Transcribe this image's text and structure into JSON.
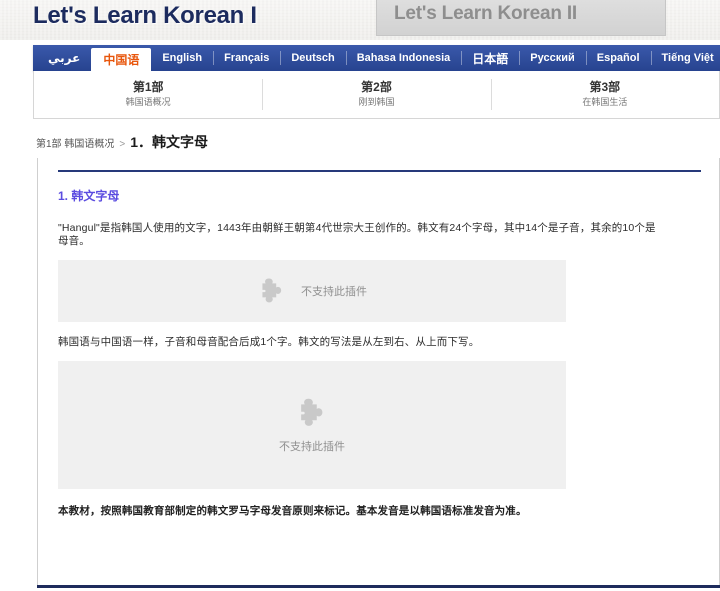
{
  "banner": {
    "title_active": "Let's Learn Korean I",
    "title_inactive": "Let's Learn Korean II"
  },
  "languages": [
    {
      "label": "عربي",
      "code": "ar",
      "active": false
    },
    {
      "label": "中国语",
      "code": "zh",
      "active": true
    },
    {
      "label": "English",
      "code": "en",
      "active": false
    },
    {
      "label": "Français",
      "code": "fr",
      "active": false
    },
    {
      "label": "Deutsch",
      "code": "de",
      "active": false
    },
    {
      "label": "Bahasa Indonesia",
      "code": "id",
      "active": false
    },
    {
      "label": "日本語",
      "code": "ja",
      "active": false
    },
    {
      "label": "Русский",
      "code": "ru",
      "active": false
    },
    {
      "label": "Español",
      "code": "es",
      "active": false
    },
    {
      "label": "Tiếng Việt",
      "code": "vi",
      "active": false
    }
  ],
  "parts": [
    {
      "title": "第1部",
      "subtitle": "韩国语概况"
    },
    {
      "title": "第2部",
      "subtitle": "刚到韩国"
    },
    {
      "title": "第3部",
      "subtitle": "在韩国生活"
    }
  ],
  "breadcrumb": {
    "parent": "第1部 韩国语概况",
    "separator": ">",
    "current": "1．韩文字母"
  },
  "content": {
    "heading": "1. 韩文字母",
    "paragraph1": "\"Hangul\"是指韩国人使用的文字，1443年由朝鲜王朝第4代世宗大王创作的。韩文有24个字母，其中14个是子音，其余的10个是母音。",
    "paragraph2": "韩国语与中国语一样，子音和母音配合后成1个字。韩文的写法是从左到右、从上而下写。",
    "paragraph3": "本教材，按照韩国教育部制定的韩文罗马字母发音原则来标记。基本发音是以韩国语标准发音为准。",
    "plugin_notice_1": "不支持此插件",
    "plugin_notice_2": "不支持此插件"
  },
  "colors": {
    "nav_blue": "#2e4d9e",
    "active_lang_text": "#e8560c",
    "heading_purple": "#5b4ce0",
    "title_navy": "#1c2b5e",
    "rule_navy": "#26397a",
    "plugin_bg": "#f0f0f0",
    "plugin_icon": "#c9c9c9"
  }
}
